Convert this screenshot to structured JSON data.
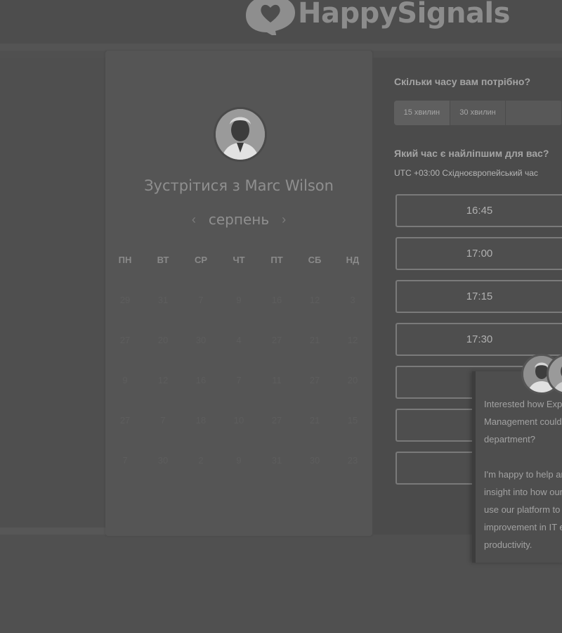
{
  "header": {
    "brand": "HappySignals"
  },
  "calendar": {
    "title": "Зустрітися з Marc Wilson",
    "month": "серпень",
    "prev_icon": "‹",
    "next_icon": "›",
    "weekdays": [
      "ПН",
      "ВТ",
      "СР",
      "ЧТ",
      "ПТ",
      "СБ",
      "НД"
    ],
    "weeks": [
      [
        "29",
        "31",
        "7",
        "9",
        "16",
        "12",
        "3"
      ],
      [
        "27",
        "20",
        "30",
        "4",
        "27",
        "21",
        "12"
      ],
      [
        "9",
        "12",
        "16",
        "7",
        "11",
        "27",
        "20"
      ],
      [
        "27",
        "7",
        "18",
        "10",
        "27",
        "21",
        "15"
      ],
      [
        "7",
        "30",
        "2",
        "9",
        "31",
        "30",
        "23"
      ]
    ]
  },
  "booking": {
    "duration_title": "Скільки часу вам потрібно?",
    "durations": [
      "15 хвилин",
      "30 хвилин"
    ],
    "time_title": "Який час є найліпшим для вас?",
    "timezone": "UTC +03:00 Східноєвропейський час",
    "slots": [
      "16:45",
      "17:00",
      "17:15",
      "17:30",
      "",
      "",
      ""
    ]
  },
  "chat": {
    "message": "Interested how Expe\nManagement could\ndepartment?\n\nI'm happy to help an\ninsight into how our\nuse our platform to\nimprovement in IT e\nproductivity."
  },
  "colors": {
    "background": "#505050",
    "card": "#555555",
    "slot_border": "#7a7a7a"
  }
}
